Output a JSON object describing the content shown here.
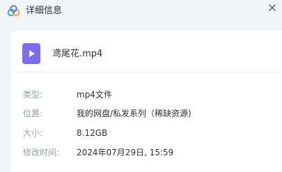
{
  "window": {
    "title": "详细信息",
    "logo_icon": "cloud-logo-icon",
    "close_icon": "close-icon"
  },
  "file": {
    "name": "鸢尾花.mp4",
    "icon": "video-file-icon",
    "icon_color": "#7b6df0"
  },
  "details": [
    {
      "label": "类型:",
      "value": "mp4文件"
    },
    {
      "label": "位置:",
      "value": "我的网盘/私发系列（稀缺资源)"
    },
    {
      "label": "大小:",
      "value": "8.12GB"
    },
    {
      "label": "修改时间:",
      "value": "2024年07月29日, 15:59"
    }
  ]
}
